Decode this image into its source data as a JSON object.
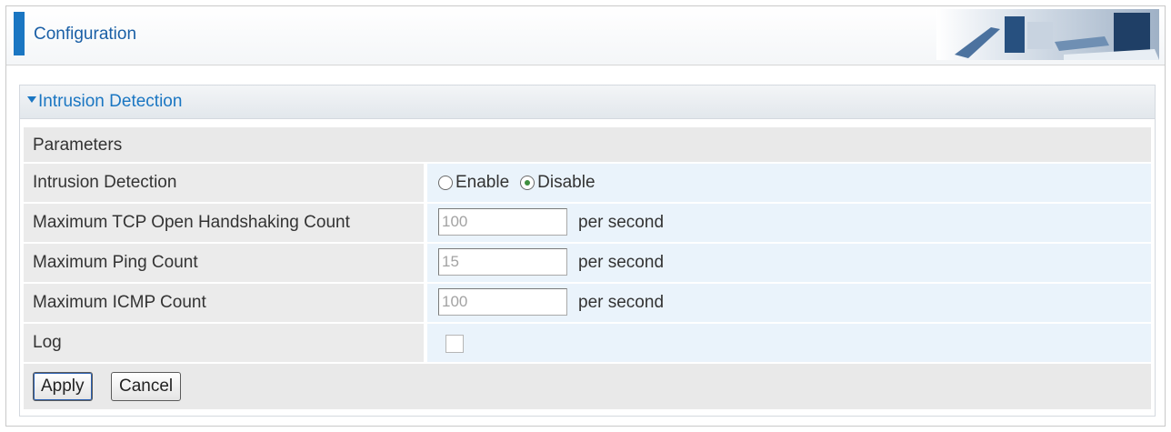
{
  "header": {
    "title": "Configuration",
    "accent_color": "#1a76c2"
  },
  "panel": {
    "title": "Intrusion Detection",
    "arrow_icon": "triangle-down-icon"
  },
  "section": {
    "title": "Parameters"
  },
  "rows": {
    "intrusion_detection": {
      "label": "Intrusion Detection",
      "options": [
        {
          "label": "Enable",
          "checked": false
        },
        {
          "label": "Disable",
          "checked": true
        }
      ]
    },
    "tcp_open": {
      "label": "Maximum TCP Open Handshaking Count",
      "value": "100",
      "unit": "per second"
    },
    "ping": {
      "label": "Maximum Ping Count",
      "value": "15",
      "unit": "per second"
    },
    "icmp": {
      "label": "Maximum ICMP Count",
      "value": "100",
      "unit": "per second"
    },
    "log": {
      "label": "Log",
      "checked": false
    }
  },
  "buttons": {
    "apply": "Apply",
    "cancel": "Cancel"
  }
}
